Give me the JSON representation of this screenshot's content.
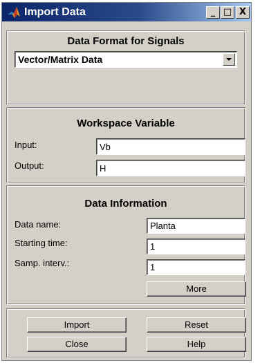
{
  "window": {
    "title": "Import Data",
    "icon": "matlab-logo-icon",
    "controls": {
      "minimize": "_",
      "maximize": "□",
      "close": "X"
    }
  },
  "data_format": {
    "title": "Data Format for Signals",
    "selected": "Vector/Matrix Data"
  },
  "workspace": {
    "title": "Workspace Variable",
    "input_label": "Input:",
    "input_value": "Vb",
    "output_label": "Output:",
    "output_value": "H"
  },
  "data_info": {
    "title": "Data Information",
    "name_label": "Data name:",
    "name_value": "Planta",
    "start_label": "Starting time:",
    "start_value": "1",
    "interval_label": "Samp. interv.:",
    "interval_value": "1",
    "more_label": "More"
  },
  "actions": {
    "import_label": "Import",
    "reset_label": "Reset",
    "close_label": "Close",
    "help_label": "Help"
  }
}
